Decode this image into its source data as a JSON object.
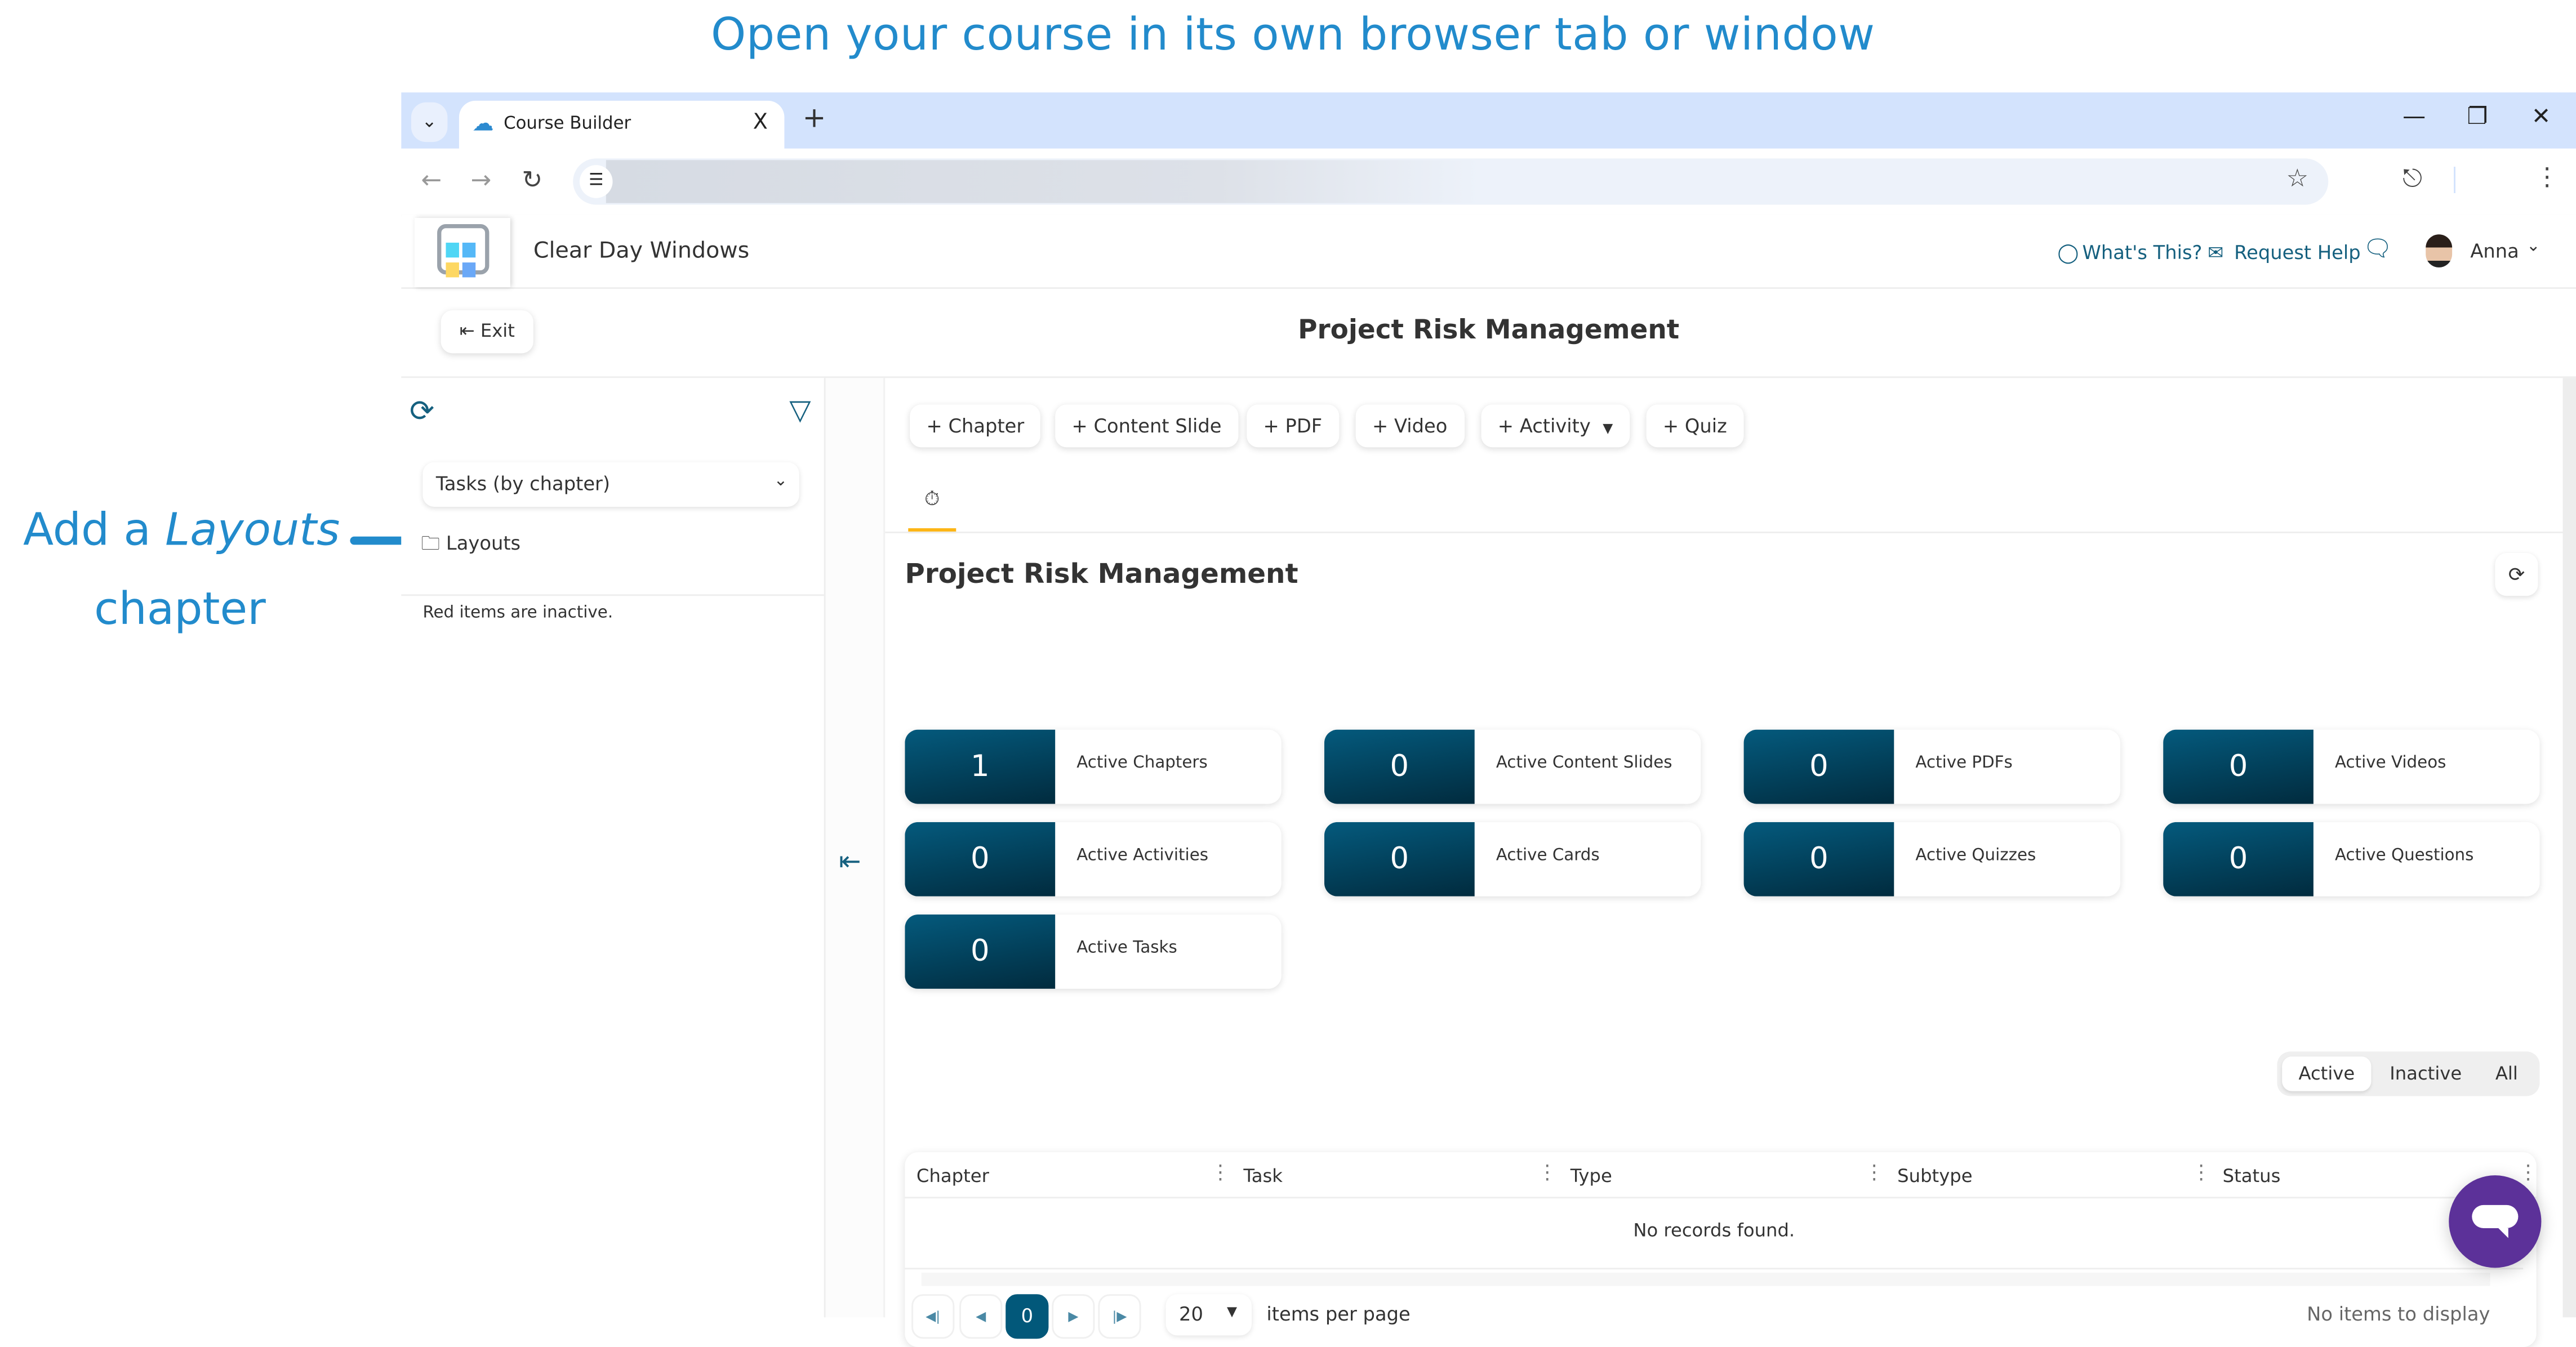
{
  "annotations": {
    "title": "Open your course in its own browser tab or window",
    "left_pre": "Add a ",
    "left_italic": "Layouts",
    "left_line2": "chapter"
  },
  "browser": {
    "tab_title": "Course Builder",
    "tab_close": "X",
    "new_tab": "+",
    "minimize": "—",
    "restore": "❐",
    "close": "✕",
    "address_value": ""
  },
  "header": {
    "company": "Clear Day Windows",
    "whats_this": "What's This?",
    "request_help": "Request Help",
    "user": "Anna"
  },
  "subheader": {
    "exit_label": "Exit",
    "course_title": "Project Risk Management"
  },
  "sidebar": {
    "view_select": "Tasks (by chapter)",
    "tree": [
      {
        "label": "Layouts",
        "type": "folder"
      }
    ],
    "note": "Red items are inactive."
  },
  "toolbar": {
    "buttons": [
      "Chapter",
      "Content Slide",
      "PDF",
      "Video",
      "Activity",
      "Quiz"
    ]
  },
  "main": {
    "title": "Project Risk Management",
    "stats": [
      {
        "value": "1",
        "label": "Active Chapters"
      },
      {
        "value": "0",
        "label": "Active Content Slides"
      },
      {
        "value": "0",
        "label": "Active PDFs"
      },
      {
        "value": "0",
        "label": "Active Videos"
      },
      {
        "value": "0",
        "label": "Active Activities"
      },
      {
        "value": "0",
        "label": "Active Cards"
      },
      {
        "value": "0",
        "label": "Active Quizzes"
      },
      {
        "value": "0",
        "label": "Active Questions"
      },
      {
        "value": "0",
        "label": "Active Tasks"
      }
    ],
    "filter_options": [
      "Active",
      "Inactive",
      "All"
    ],
    "filter_selected": "Active"
  },
  "grid": {
    "columns": [
      "Chapter",
      "Task",
      "Type",
      "Subtype",
      "Status"
    ],
    "empty_message": "No records found.",
    "current_page": "0",
    "page_size": "20",
    "items_per_page_label": "items per page",
    "status": "No items to display"
  },
  "colors": {
    "accent": "#15607f",
    "stat_tile": "#045a7d",
    "annotation": "#228bcc",
    "tab_indicator": "#fdb515",
    "chat": "#5c3199"
  }
}
